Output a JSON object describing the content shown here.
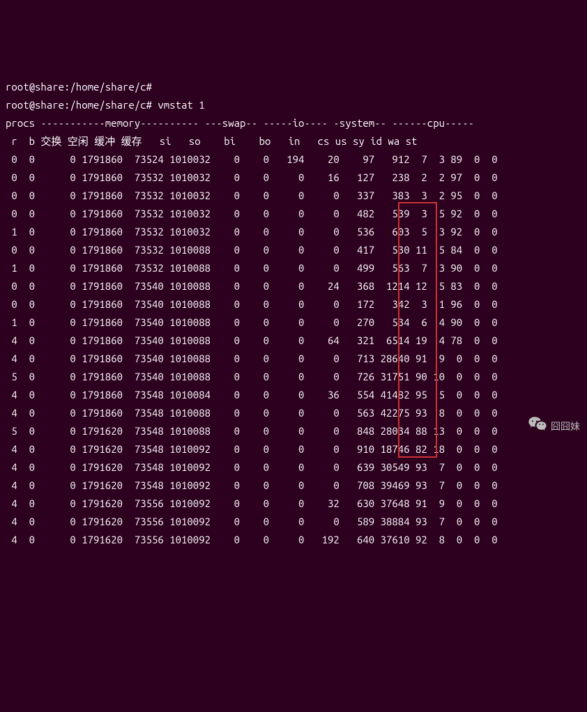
{
  "prompt_lines": [
    "root@share:/home/share/c#",
    "root@share:/home/share/c# vmstat 1"
  ],
  "header1": "procs -----------memory---------- ---swap-- -----io---- -system-- ------cpu-----",
  "header2": {
    "r": "r",
    "b": "b",
    "swap": "交换",
    "free": "空闲",
    "buff": "缓冲",
    "cache": "缓存",
    "si": "si",
    "so": "so",
    "bi": "bi",
    "bo": "bo",
    "in": "in",
    "cs": "cs",
    "us": "us",
    "sy": "sy",
    "id": "id",
    "wa": "wa",
    "st": "st"
  },
  "rows": [
    {
      "r": 0,
      "b": 0,
      "swpd": 0,
      "free": 1791860,
      "buff": 73524,
      "cache": 1010032,
      "si": 0,
      "so": 0,
      "bi": 194,
      "bo": 20,
      "in": 97,
      "cs": 912,
      "us": 7,
      "sy": 3,
      "id": 89,
      "wa": 0,
      "st": 0
    },
    {
      "r": 0,
      "b": 0,
      "swpd": 0,
      "free": 1791860,
      "buff": 73532,
      "cache": 1010032,
      "si": 0,
      "so": 0,
      "bi": 0,
      "bo": 16,
      "in": 127,
      "cs": 238,
      "us": 2,
      "sy": 2,
      "id": 97,
      "wa": 0,
      "st": 0
    },
    {
      "r": 0,
      "b": 0,
      "swpd": 0,
      "free": 1791860,
      "buff": 73532,
      "cache": 1010032,
      "si": 0,
      "so": 0,
      "bi": 0,
      "bo": 0,
      "in": 337,
      "cs": 383,
      "us": 3,
      "sy": 2,
      "id": 95,
      "wa": 0,
      "st": 0
    },
    {
      "r": 0,
      "b": 0,
      "swpd": 0,
      "free": 1791860,
      "buff": 73532,
      "cache": 1010032,
      "si": 0,
      "so": 0,
      "bi": 0,
      "bo": 0,
      "in": 482,
      "cs": 539,
      "us": 3,
      "sy": 5,
      "id": 92,
      "wa": 0,
      "st": 0
    },
    {
      "r": 1,
      "b": 0,
      "swpd": 0,
      "free": 1791860,
      "buff": 73532,
      "cache": 1010032,
      "si": 0,
      "so": 0,
      "bi": 0,
      "bo": 0,
      "in": 536,
      "cs": 603,
      "us": 5,
      "sy": 3,
      "id": 92,
      "wa": 0,
      "st": 0
    },
    {
      "r": 0,
      "b": 0,
      "swpd": 0,
      "free": 1791860,
      "buff": 73532,
      "cache": 1010088,
      "si": 0,
      "so": 0,
      "bi": 0,
      "bo": 0,
      "in": 417,
      "cs": 530,
      "us": 11,
      "sy": 5,
      "id": 84,
      "wa": 0,
      "st": 0
    },
    {
      "r": 1,
      "b": 0,
      "swpd": 0,
      "free": 1791860,
      "buff": 73532,
      "cache": 1010088,
      "si": 0,
      "so": 0,
      "bi": 0,
      "bo": 0,
      "in": 499,
      "cs": 563,
      "us": 7,
      "sy": 3,
      "id": 90,
      "wa": 0,
      "st": 0
    },
    {
      "r": 0,
      "b": 0,
      "swpd": 0,
      "free": 1791860,
      "buff": 73540,
      "cache": 1010088,
      "si": 0,
      "so": 0,
      "bi": 0,
      "bo": 24,
      "in": 368,
      "cs": 1214,
      "us": 12,
      "sy": 5,
      "id": 83,
      "wa": 0,
      "st": 0
    },
    {
      "r": 0,
      "b": 0,
      "swpd": 0,
      "free": 1791860,
      "buff": 73540,
      "cache": 1010088,
      "si": 0,
      "so": 0,
      "bi": 0,
      "bo": 0,
      "in": 172,
      "cs": 342,
      "us": 3,
      "sy": 1,
      "id": 96,
      "wa": 0,
      "st": 0
    },
    {
      "r": 1,
      "b": 0,
      "swpd": 0,
      "free": 1791860,
      "buff": 73540,
      "cache": 1010088,
      "si": 0,
      "so": 0,
      "bi": 0,
      "bo": 0,
      "in": 270,
      "cs": 534,
      "us": 6,
      "sy": 4,
      "id": 90,
      "wa": 0,
      "st": 0
    },
    {
      "r": 4,
      "b": 0,
      "swpd": 0,
      "free": 1791860,
      "buff": 73540,
      "cache": 1010088,
      "si": 0,
      "so": 0,
      "bi": 0,
      "bo": 64,
      "in": 321,
      "cs": 6514,
      "us": 19,
      "sy": 4,
      "id": 78,
      "wa": 0,
      "st": 0
    },
    {
      "r": 4,
      "b": 0,
      "swpd": 0,
      "free": 1791860,
      "buff": 73540,
      "cache": 1010088,
      "si": 0,
      "so": 0,
      "bi": 0,
      "bo": 0,
      "in": 713,
      "cs": 28640,
      "us": 91,
      "sy": 9,
      "id": 0,
      "wa": 0,
      "st": 0
    },
    {
      "r": 5,
      "b": 0,
      "swpd": 0,
      "free": 1791860,
      "buff": 73540,
      "cache": 1010088,
      "si": 0,
      "so": 0,
      "bi": 0,
      "bo": 0,
      "in": 726,
      "cs": 31751,
      "us": 90,
      "sy": 10,
      "id": 0,
      "wa": 0,
      "st": 0
    },
    {
      "r": 4,
      "b": 0,
      "swpd": 0,
      "free": 1791860,
      "buff": 73548,
      "cache": 1010084,
      "si": 0,
      "so": 0,
      "bi": 0,
      "bo": 36,
      "in": 554,
      "cs": 41482,
      "us": 95,
      "sy": 5,
      "id": 0,
      "wa": 0,
      "st": 0
    },
    {
      "r": 4,
      "b": 0,
      "swpd": 0,
      "free": 1791860,
      "buff": 73548,
      "cache": 1010088,
      "si": 0,
      "so": 0,
      "bi": 0,
      "bo": 0,
      "in": 563,
      "cs": 42275,
      "us": 93,
      "sy": 8,
      "id": 0,
      "wa": 0,
      "st": 0
    },
    {
      "r": 5,
      "b": 0,
      "swpd": 0,
      "free": 1791620,
      "buff": 73548,
      "cache": 1010088,
      "si": 0,
      "so": 0,
      "bi": 0,
      "bo": 0,
      "in": 848,
      "cs": 28034,
      "us": 88,
      "sy": 13,
      "id": 0,
      "wa": 0,
      "st": 0
    },
    {
      "r": 4,
      "b": 0,
      "swpd": 0,
      "free": 1791620,
      "buff": 73548,
      "cache": 1010092,
      "si": 0,
      "so": 0,
      "bi": 0,
      "bo": 0,
      "in": 910,
      "cs": 18746,
      "us": 82,
      "sy": 18,
      "id": 0,
      "wa": 0,
      "st": 0
    },
    {
      "r": 4,
      "b": 0,
      "swpd": 0,
      "free": 1791620,
      "buff": 73548,
      "cache": 1010092,
      "si": 0,
      "so": 0,
      "bi": 0,
      "bo": 0,
      "in": 639,
      "cs": 30549,
      "us": 93,
      "sy": 7,
      "id": 0,
      "wa": 0,
      "st": 0
    },
    {
      "r": 4,
      "b": 0,
      "swpd": 0,
      "free": 1791620,
      "buff": 73548,
      "cache": 1010092,
      "si": 0,
      "so": 0,
      "bi": 0,
      "bo": 0,
      "in": 708,
      "cs": 39469,
      "us": 93,
      "sy": 7,
      "id": 0,
      "wa": 0,
      "st": 0
    },
    {
      "r": 4,
      "b": 0,
      "swpd": 0,
      "free": 1791620,
      "buff": 73556,
      "cache": 1010092,
      "si": 0,
      "so": 0,
      "bi": 0,
      "bo": 32,
      "in": 630,
      "cs": 37648,
      "us": 91,
      "sy": 9,
      "id": 0,
      "wa": 0,
      "st": 0
    },
    {
      "r": 4,
      "b": 0,
      "swpd": 0,
      "free": 1791620,
      "buff": 73556,
      "cache": 1010092,
      "si": 0,
      "so": 0,
      "bi": 0,
      "bo": 0,
      "in": 589,
      "cs": 38884,
      "us": 93,
      "sy": 7,
      "id": 0,
      "wa": 0,
      "st": 0
    },
    {
      "r": 4,
      "b": 0,
      "swpd": 0,
      "free": 1791620,
      "buff": 73556,
      "cache": 1010092,
      "si": 0,
      "so": 0,
      "bi": 0,
      "bo": 192,
      "in": 640,
      "cs": 37610,
      "us": 92,
      "sy": 8,
      "id": 0,
      "wa": 0,
      "st": 0
    }
  ],
  "watermark_text": "囧囧妹"
}
